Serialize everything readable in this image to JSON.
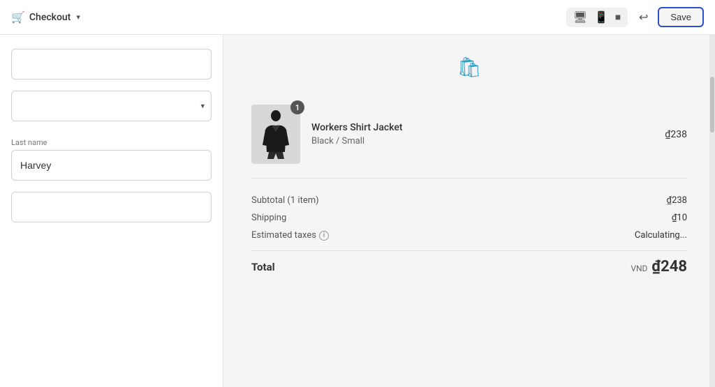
{
  "header": {
    "checkout_icon": "🛒",
    "title": "Checkout",
    "chevron": "▾",
    "device_icons": [
      "desktop",
      "tablet",
      "mobile"
    ],
    "undo_icon": "↩",
    "save_label": "Save"
  },
  "bag_icon": "🛍",
  "product": {
    "name": "Workers Shirt Jacket",
    "variant": "Black / Small",
    "price": "₫238",
    "badge": "1"
  },
  "order": {
    "subtotal_label": "Subtotal (1 item)",
    "subtotal_value": "₫238",
    "shipping_label": "Shipping",
    "shipping_value": "₫10",
    "taxes_label": "Estimated taxes",
    "taxes_value": "Calculating...",
    "total_label": "Total",
    "total_currency": "VND",
    "total_amount": "₫248"
  },
  "form": {
    "last_name_label": "Last name",
    "last_name_value": "Harvey"
  }
}
